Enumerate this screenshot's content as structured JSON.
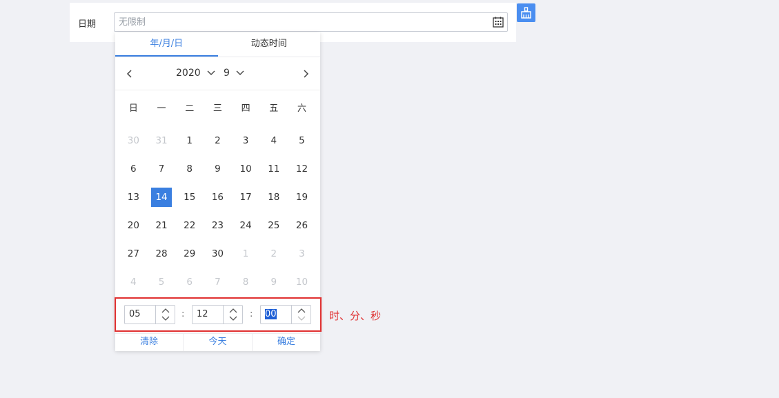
{
  "form": {
    "date_label": "日期",
    "date_placeholder": "无限制"
  },
  "picker": {
    "tabs": [
      {
        "label": "年/月/日",
        "active": true
      },
      {
        "label": "动态时间",
        "active": false
      }
    ],
    "year": "2020",
    "month": "9",
    "weekdays": [
      "日",
      "一",
      "二",
      "三",
      "四",
      "五",
      "六"
    ],
    "days": [
      {
        "d": "30",
        "muted": true
      },
      {
        "d": "31",
        "muted": true
      },
      {
        "d": "1"
      },
      {
        "d": "2"
      },
      {
        "d": "3"
      },
      {
        "d": "4"
      },
      {
        "d": "5"
      },
      {
        "d": "6"
      },
      {
        "d": "7"
      },
      {
        "d": "8"
      },
      {
        "d": "9"
      },
      {
        "d": "10"
      },
      {
        "d": "11"
      },
      {
        "d": "12"
      },
      {
        "d": "13"
      },
      {
        "d": "14",
        "selected": true
      },
      {
        "d": "15"
      },
      {
        "d": "16"
      },
      {
        "d": "17"
      },
      {
        "d": "18"
      },
      {
        "d": "19"
      },
      {
        "d": "20"
      },
      {
        "d": "21"
      },
      {
        "d": "22"
      },
      {
        "d": "23"
      },
      {
        "d": "24"
      },
      {
        "d": "25"
      },
      {
        "d": "26"
      },
      {
        "d": "27"
      },
      {
        "d": "28"
      },
      {
        "d": "29"
      },
      {
        "d": "30"
      },
      {
        "d": "1",
        "muted": true
      },
      {
        "d": "2",
        "muted": true
      },
      {
        "d": "3",
        "muted": true
      },
      {
        "d": "4",
        "muted": true
      },
      {
        "d": "5",
        "muted": true
      },
      {
        "d": "6",
        "muted": true
      },
      {
        "d": "7",
        "muted": true
      },
      {
        "d": "8",
        "muted": true
      },
      {
        "d": "9",
        "muted": true
      },
      {
        "d": "10",
        "muted": true
      }
    ],
    "time": {
      "hour": "05",
      "minute": "12",
      "second": "00",
      "separator": ":"
    },
    "footer": {
      "clear": "清除",
      "today": "今天",
      "confirm": "确定"
    }
  },
  "annotation": "时、分、秒",
  "colors": {
    "accent": "#3a7fe0",
    "annotation": "#e03030",
    "muted_day": "#c4c7cc",
    "clean_button": "#4a8ef0"
  },
  "icons": {
    "date_field": "calendar-icon",
    "clean_button": "broom-icon",
    "prev": "chevron-left-icon",
    "next": "chevron-right-icon"
  }
}
